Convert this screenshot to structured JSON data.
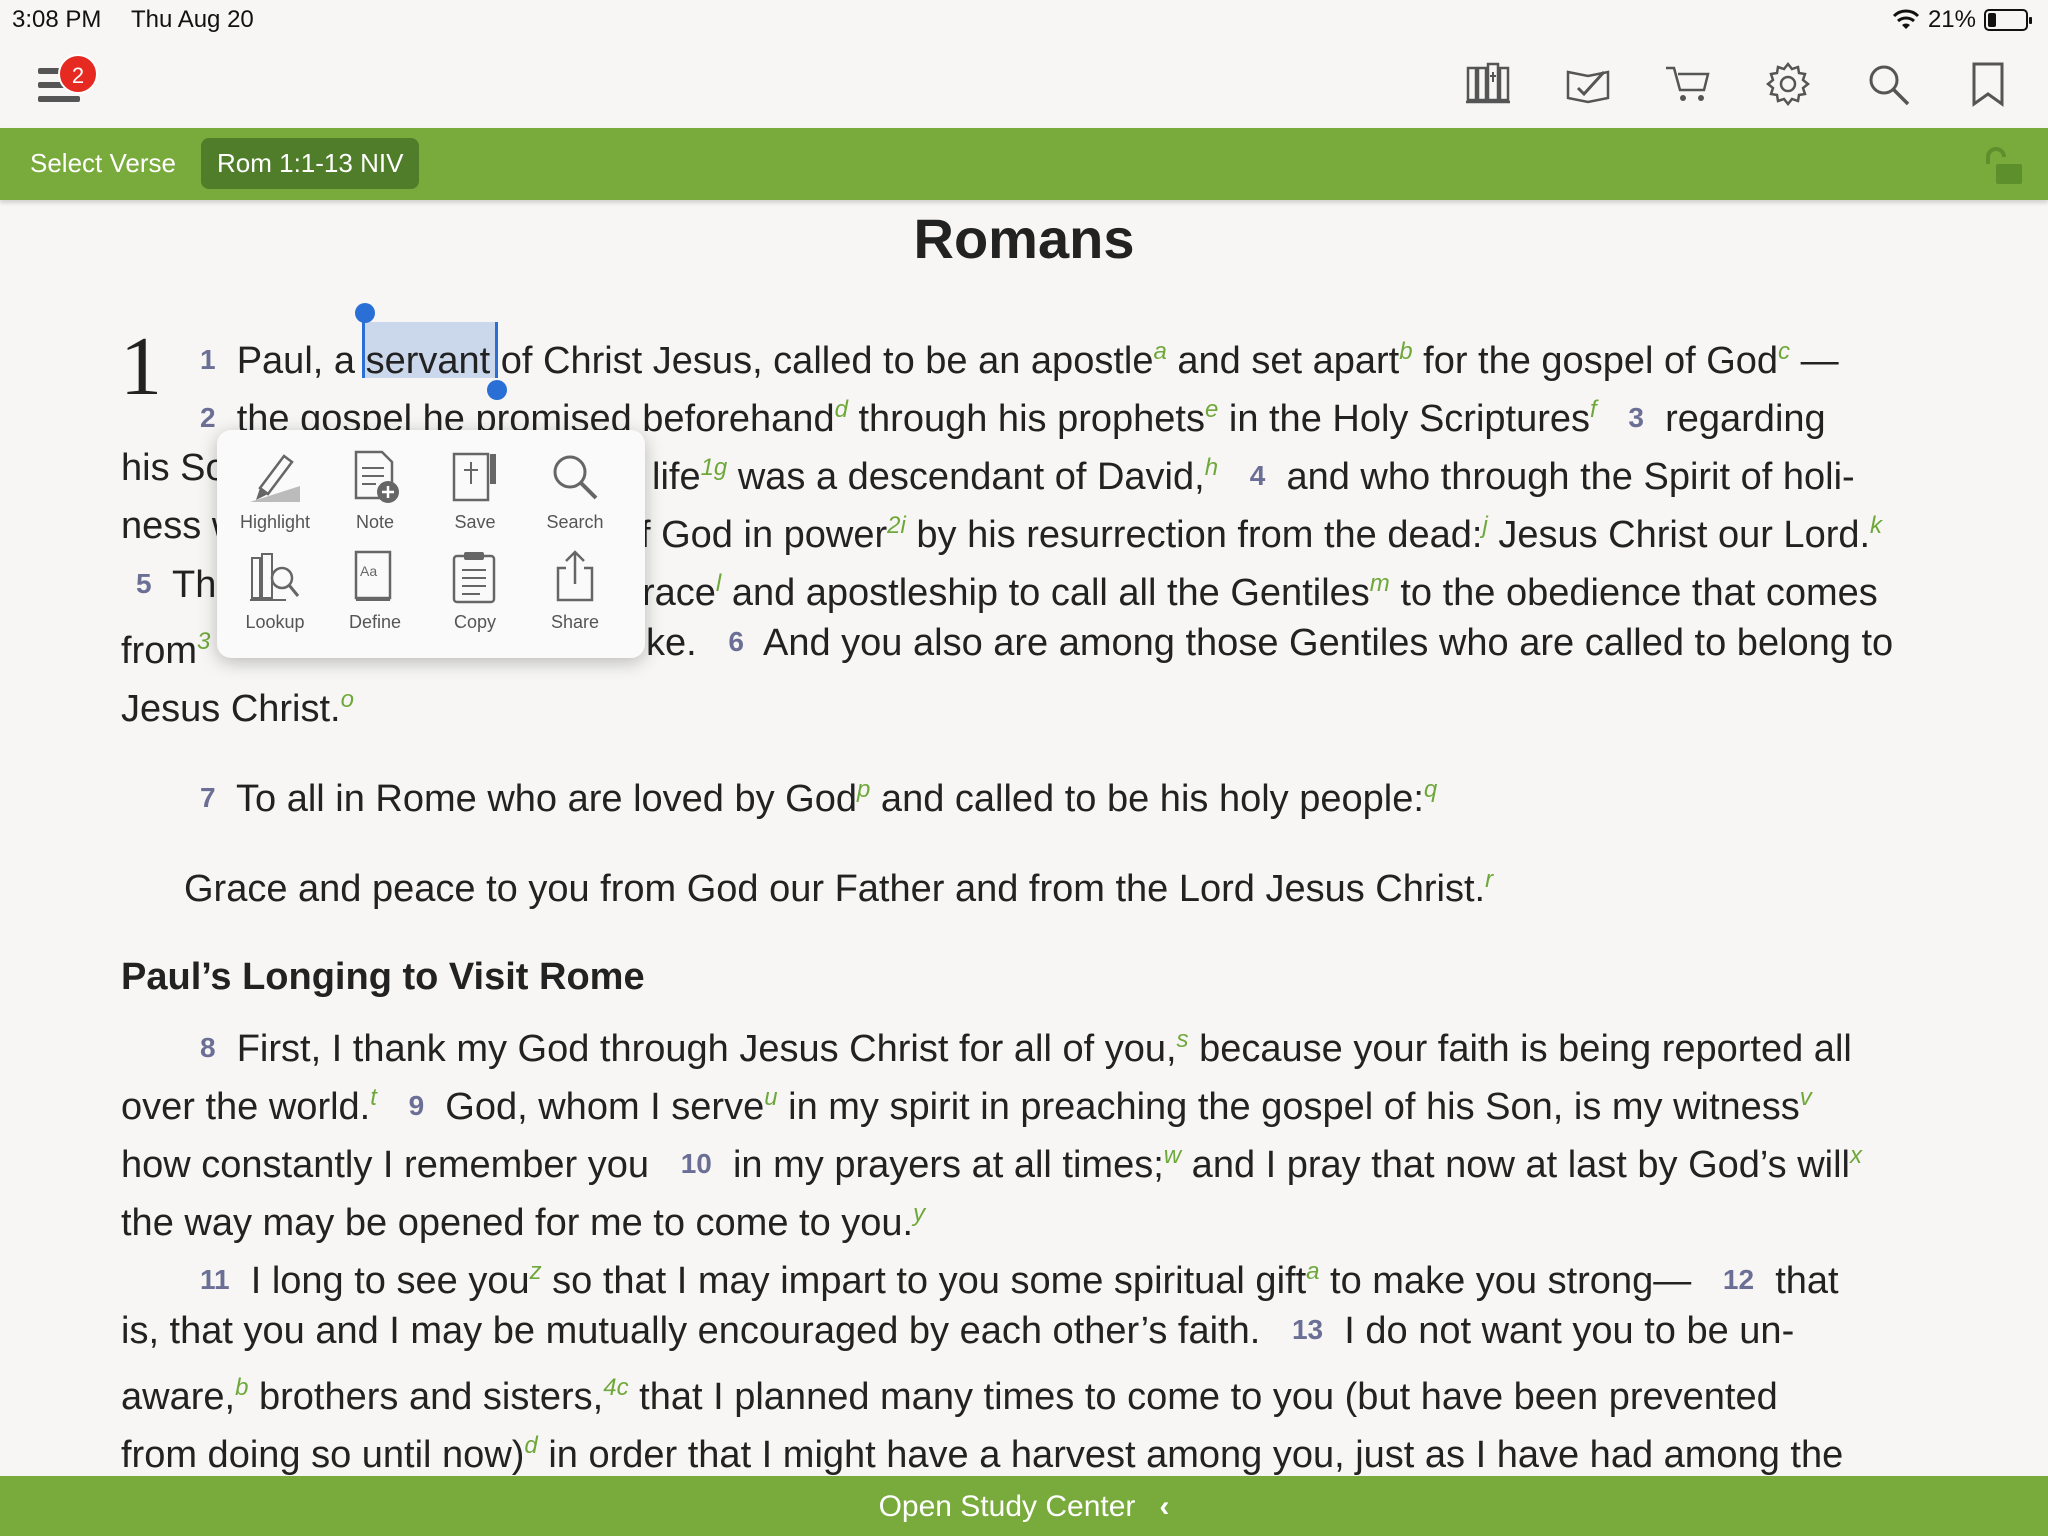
{
  "status": {
    "time": "3:08 PM",
    "date": "Thu Aug 20",
    "battery": "21%",
    "battery_level": 0.21
  },
  "toolbar": {
    "badge_count": "2",
    "icons": [
      "library-icon",
      "reading-plan-icon",
      "cart-icon",
      "gear-icon",
      "search-icon",
      "bookmark-icon"
    ]
  },
  "versebar": {
    "select_label": "Select Verse",
    "reference": "Rom 1:1-13 NIV"
  },
  "book_title": "Romans",
  "chapter": "1",
  "popup": {
    "items": [
      {
        "label": "Highlight",
        "icon": "highlight-icon"
      },
      {
        "label": "Note",
        "icon": "note-icon"
      },
      {
        "label": "Save",
        "icon": "save-icon"
      },
      {
        "label": "Search",
        "icon": "search-icon"
      },
      {
        "label": "Lookup",
        "icon": "lookup-icon"
      },
      {
        "label": "Define",
        "icon": "define-icon"
      },
      {
        "label": "Copy",
        "icon": "copy-icon"
      },
      {
        "label": "Share",
        "icon": "share-icon"
      }
    ]
  },
  "text": {
    "l1": {
      "v1": "1",
      "t1": "Paul, a ",
      "sel": "servant",
      "t2": " of Christ Jesus, called to be an apostle",
      "fa": "a",
      "t3": " and set apart",
      "fb": "b",
      "t4": " for the gospel of God",
      "fc": "c",
      "t5": " —"
    },
    "l2": {
      "v2": "2",
      "t1": "the gospel he promised beforehand",
      "fd": "d",
      "t2": " through his prophets",
      "fe": "e",
      "t3": " in the Holy Scriptures",
      "ff": "f",
      "v3": "3",
      "t4": "regarding"
    },
    "l3": {
      "a": "his So",
      "b": "life",
      "f1": "1g",
      "c": " was a descendant of David,",
      "fh": "h",
      "v4": "4",
      "d": "and who through the Spirit of holi-"
    },
    "l4": {
      "a": "ness w",
      "b": "f God in power",
      "f2": "2i",
      "c": " by his resurrection from the dead:",
      "fj": "j",
      "d": " Jesus Christ our Lord.",
      "fk": "k"
    },
    "l5": {
      "v5": "5",
      "a": "Th",
      "b": "race",
      "fl": "l",
      "c": " and apostleship to call all the Gentiles",
      "fm": "m",
      "d": " to the obedience that comes"
    },
    "l6": {
      "a": "from",
      "f3": "3",
      "b": "ke.",
      "v6": "6",
      "c": "And you also are among those Gentiles who are called to belong to"
    },
    "l7": {
      "a": "Jesus Christ.",
      "fo": "o"
    },
    "l8": {
      "v7": "7",
      "a": "To all in Rome who are loved by God",
      "fp": "p",
      "b": " and called to be his holy people:",
      "fq": "q"
    },
    "l9": {
      "a": "Grace and peace to you from God our Father and from the Lord Jesus Christ.",
      "fr": "r"
    },
    "heading": "Paul’s Longing to Visit Rome",
    "l10": {
      "v8": "8",
      "a": "First, I thank my God through Jesus Christ for all of you,",
      "fs": "s",
      "b": " because your faith is being reported all"
    },
    "l11": {
      "a": "over the world.",
      "ft": "t",
      "v9": "9",
      "b": "God, whom I serve",
      "fu": "u",
      "c": " in my spirit in preaching the gospel of his Son, is my witness",
      "fv": "v"
    },
    "l12": {
      "a": "how constantly I remember you",
      "v10": "10",
      "b": "in my prayers at all times;",
      "fw": "w",
      "c": " and I pray that now at last by God’s will",
      "fx": "x"
    },
    "l13": {
      "a": "the way may be opened for me to come to you.",
      "fy": "y"
    },
    "l14": {
      "v11": "11",
      "a": "I long to see you",
      "fz": "z",
      "b": " so that I may impart to you some spiritual gift",
      "fa": "a",
      "c": " to make you strong—",
      "v12": "12",
      "d": "that"
    },
    "l15": {
      "a": "is, that you and I may be mutually encouraged by each other’s faith.",
      "v13": "13",
      "b": "I do not want you to be un-"
    },
    "l16": {
      "a": "aware,",
      "fb": "b",
      "b": " brothers and sisters,",
      "f4": "4c",
      "c": " that I planned many times to come to you (but have been prevented"
    },
    "l17": {
      "a": "from doing so until now)",
      "fd": "d",
      "b": " in order that I might have a harvest among you, just as I have had among the"
    }
  },
  "bottombar": {
    "label": "Open Study Center",
    "chevron": "‹"
  }
}
